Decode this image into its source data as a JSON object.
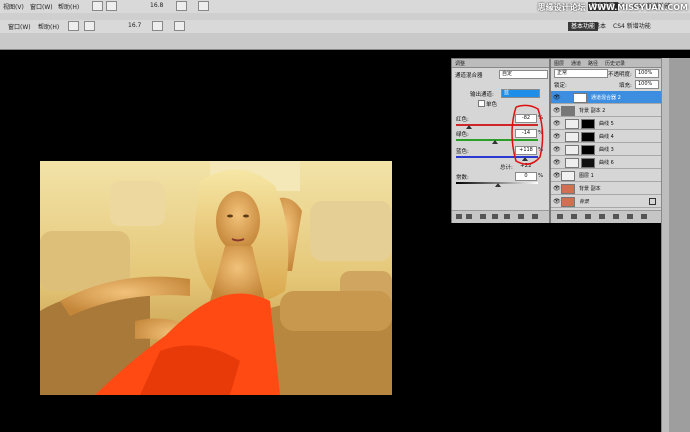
{
  "menubar": {
    "items": [
      "视图(V)",
      "窗口(W)",
      "帮助(H)"
    ],
    "zoom": "16.8",
    "workspace_active": "基本功能",
    "workspace_items": [
      "基本",
      "CS4 新增功能"
    ]
  },
  "menubar2": {
    "items": [
      "窗口(W)",
      "帮助(H)"
    ],
    "zoom": "16.7",
    "workspace_active": "基本功能",
    "workspace_items": [
      "基本",
      "CS4 新增功能"
    ]
  },
  "watermark": "思缘设计论坛 WWW.MISSYUAN.COM",
  "adjustments": {
    "tabs": [
      "调整"
    ],
    "title": "通道混合器",
    "preset": "自定",
    "output_label": "输出通道:",
    "output_value": "蓝",
    "mono_label": "单色",
    "channels": [
      {
        "label": "红色:",
        "value": "-82",
        "unit": "%",
        "color": "#d0262a"
      },
      {
        "label": "绿色:",
        "value": "-14",
        "unit": "%",
        "color": "#2aa02a"
      },
      {
        "label": "蓝色:",
        "value": "+118",
        "unit": "%",
        "color": "#2a3ad0"
      }
    ],
    "total_label": "总计:",
    "total_value": "+22",
    "constant_label": "常数:",
    "constant_value": "0",
    "constant_unit": "%"
  },
  "layers": {
    "tabs": [
      "图层",
      "通道",
      "路径",
      "历史记录"
    ],
    "blend_mode": "正常",
    "opacity_label": "不透明度:",
    "opacity_value": "100%",
    "fill_label": "填充:",
    "fill_value": "100%",
    "lock_label": "锁定:",
    "rows": [
      {
        "name": "通道混合器 2",
        "selected": true
      },
      {
        "name": "背景 副本 2",
        "selected": false
      },
      {
        "name": "曲线 5",
        "selected": false
      },
      {
        "name": "曲线 4",
        "selected": false
      },
      {
        "name": "曲线 3",
        "selected": false
      },
      {
        "name": "曲线 6",
        "selected": false
      },
      {
        "name": "图层 1",
        "selected": false
      },
      {
        "name": "背景 副本",
        "selected": false
      },
      {
        "name": "背景",
        "selected": false
      }
    ]
  }
}
